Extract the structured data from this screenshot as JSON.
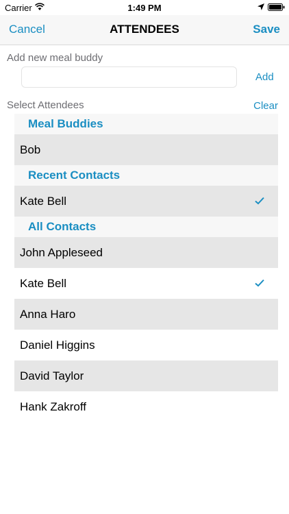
{
  "status": {
    "carrier": "Carrier",
    "time": "1:49 PM"
  },
  "nav": {
    "cancel": "Cancel",
    "title": "ATTENDEES",
    "save": "Save"
  },
  "add_section": {
    "label": "Add new meal buddy",
    "input_value": "",
    "input_placeholder": "",
    "add_button": "Add"
  },
  "select_section": {
    "label": "Select Attendees",
    "clear_button": "Clear"
  },
  "sections": [
    {
      "header": "Meal Buddies",
      "rows": [
        {
          "name": "Bob",
          "checked": false
        }
      ]
    },
    {
      "header": "Recent Contacts",
      "rows": [
        {
          "name": "Kate Bell",
          "checked": true
        }
      ]
    },
    {
      "header": "All Contacts",
      "rows": [
        {
          "name": "John Appleseed",
          "checked": false
        },
        {
          "name": "Kate Bell",
          "checked": true
        },
        {
          "name": "Anna Haro",
          "checked": false
        },
        {
          "name": "Daniel Higgins",
          "checked": false
        },
        {
          "name": "David Taylor",
          "checked": false
        },
        {
          "name": "Hank Zakroff",
          "checked": false
        }
      ]
    }
  ],
  "colors": {
    "accent": "#1a8ec2",
    "row_alt": "#e6e6e6",
    "header_bg": "#f7f7f7"
  },
  "icons": [
    "wifi-icon",
    "location-icon",
    "battery-icon",
    "checkmark-icon"
  ]
}
